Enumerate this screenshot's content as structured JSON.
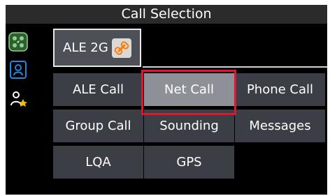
{
  "header": {
    "title": "Call Selection"
  },
  "sidebar": {
    "items": [
      {
        "icon": "network-group-icon"
      },
      {
        "icon": "contact-card-icon"
      },
      {
        "icon": "favorite-contact-icon"
      }
    ]
  },
  "mode": {
    "label": "ALE 2G",
    "icon": "link-icon"
  },
  "grid": {
    "buttons": [
      "ALE Call",
      "Net Call",
      "Phone Call",
      "Group Call",
      "Sounding",
      "Messages",
      "LQA",
      "GPS"
    ],
    "selected": "Net Call"
  },
  "colors": {
    "selection": "#e0152f",
    "accent_blue": "#1e88e5",
    "accent_yellow": "#f6b800"
  }
}
